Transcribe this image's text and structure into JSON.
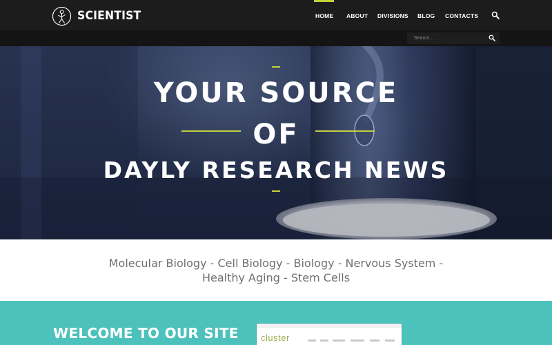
{
  "header": {
    "logo_text": "SCIENTIST",
    "nav": [
      {
        "label": "HOME",
        "active": true
      },
      {
        "label": "ABOUT",
        "active": false
      },
      {
        "label": "DIVISIONS",
        "active": false
      },
      {
        "label": "BLOG",
        "active": false
      },
      {
        "label": "CONTACTS",
        "active": false
      }
    ],
    "search": {
      "placeholder": "Search...",
      "value": ""
    }
  },
  "hero": {
    "line1": "YOUR SOURCE",
    "line2": "OF",
    "line3": "DAYLY RESEARCH NEWS"
  },
  "tagline": {
    "line1": "Molecular Biology - Cell Biology - Biology - Nervous System -",
    "line2": "Healthy Aging - Stem Cells"
  },
  "welcome": {
    "title": "WELCOME TO OUR SITE",
    "preview_logo": "cluster"
  },
  "colors": {
    "accent": "#c3d13f",
    "header_bg": "#1c1c1c",
    "teal": "#4dc1bc",
    "hero_bg": "#24304c"
  }
}
